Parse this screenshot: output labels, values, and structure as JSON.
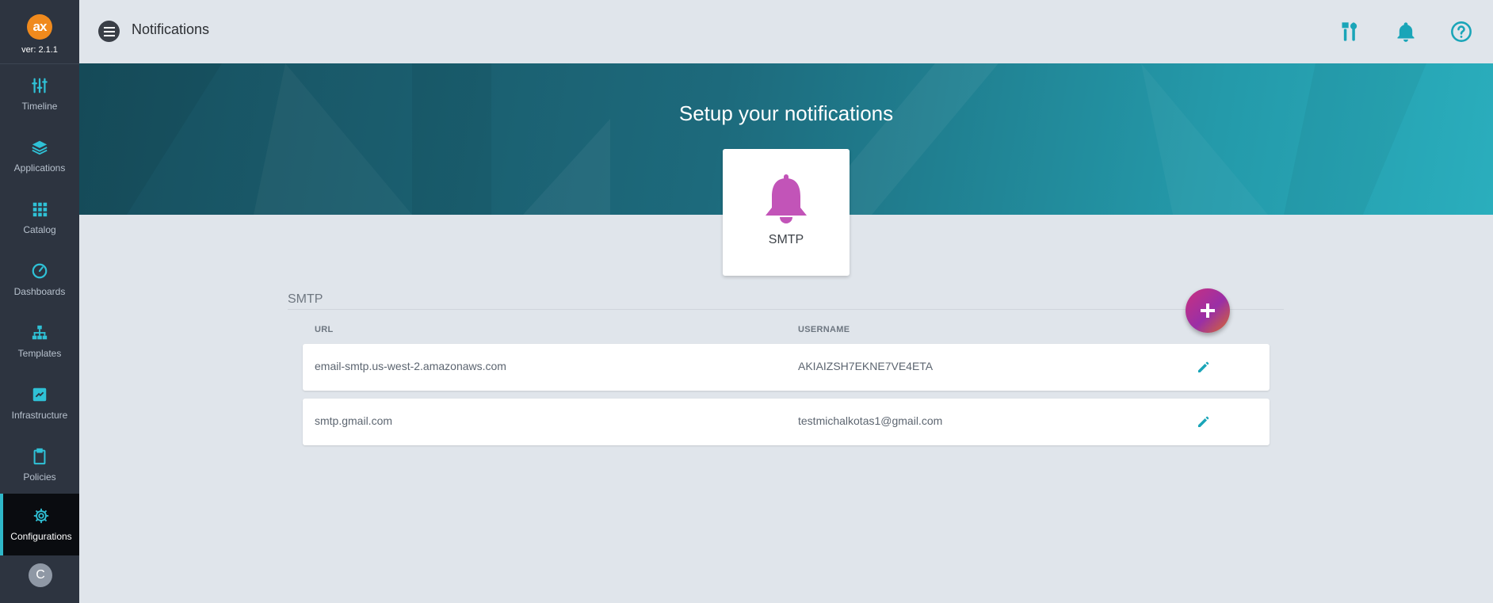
{
  "app": {
    "logo_text": "ax",
    "version": "ver: 2.1.1"
  },
  "sidebar": {
    "items": [
      {
        "label": "Timeline",
        "icon": "sliders-icon"
      },
      {
        "label": "Applications",
        "icon": "layers-icon"
      },
      {
        "label": "Catalog",
        "icon": "grid-icon"
      },
      {
        "label": "Dashboards",
        "icon": "gauge-icon"
      },
      {
        "label": "Templates",
        "icon": "sitemap-icon"
      },
      {
        "label": "Infrastructure",
        "icon": "infrastructure-icon"
      },
      {
        "label": "Policies",
        "icon": "clipboard-icon"
      },
      {
        "label": "Configurations",
        "icon": "gear-icon",
        "active": true
      }
    ],
    "avatar_initial": "C"
  },
  "header": {
    "title": "Notifications",
    "icons": [
      "tools-icon",
      "bell-icon",
      "help-icon"
    ]
  },
  "banner": {
    "title": "Setup your notifications",
    "card_label": "SMTP"
  },
  "section": {
    "title": "SMTP",
    "columns": [
      "URL",
      "USERNAME"
    ],
    "rows": [
      {
        "url": "email-smtp.us-west-2.amazonaws.com",
        "username": "AKIAIZSH7EKNE7VE4ETA"
      },
      {
        "url": "smtp.gmail.com",
        "username": "testmichalkotas1@gmail.com"
      }
    ]
  },
  "colors": {
    "sidebar_bg": "#2d3440",
    "accent": "#1aa5b8",
    "add_button": "#b8338f",
    "bell_card": "#c254b8"
  }
}
